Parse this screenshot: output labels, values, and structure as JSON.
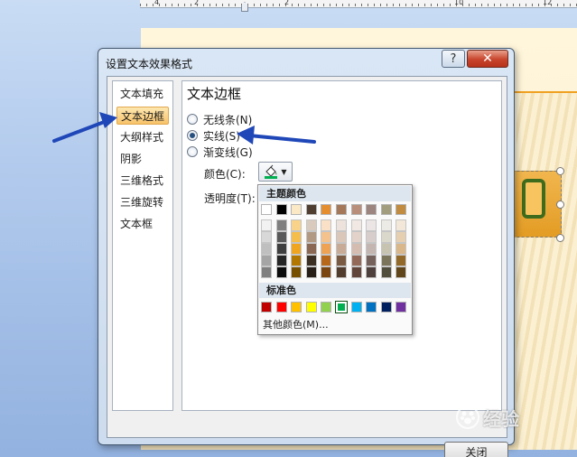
{
  "ruler": {
    "numbers": [
      "4",
      "2",
      "2",
      "10",
      "12"
    ]
  },
  "dialog": {
    "title": "设置文本效果格式",
    "help_label": "?",
    "close_label": "✕",
    "close_button_label": "关闭"
  },
  "nav": {
    "items": [
      {
        "label": "文本填充"
      },
      {
        "label": "文本边框",
        "selected": true
      },
      {
        "label": "大纲样式"
      },
      {
        "label": "阴影"
      },
      {
        "label": "三维格式"
      },
      {
        "label": "三维旋转"
      },
      {
        "label": "文本框"
      }
    ]
  },
  "pane": {
    "title": "文本边框",
    "radios": [
      {
        "label": "无线条(N)",
        "checked": false
      },
      {
        "label": "实线(S)",
        "checked": true
      },
      {
        "label": "渐变线(G)",
        "checked": false
      }
    ],
    "color_label": "颜色(C):",
    "transparency_label": "透明度(T):"
  },
  "color_menu": {
    "theme_header": "主题颜色",
    "standard_header": "标准色",
    "more_colors_label": "其他颜色(M)...",
    "theme_colors": [
      [
        "#ffffff",
        "#f2f2f2",
        "#d8d8d8",
        "#bfbfbf",
        "#a5a5a5",
        "#7f7f7f"
      ],
      [
        "#000000",
        "#7f7f7f",
        "#595959",
        "#3f3f3f",
        "#262626",
        "#0c0c0c"
      ],
      [
        "#fbe9c6",
        "#f8d389",
        "#f5bd4c",
        "#efa520",
        "#b17700",
        "#764f00"
      ],
      [
        "#4f3e2f",
        "#d8cbbd",
        "#b19984",
        "#8a6853",
        "#3b2e23",
        "#271f17"
      ],
      [
        "#e48e2f",
        "#f9e0c6",
        "#f4c28d",
        "#eea354",
        "#b8681a",
        "#7a4510"
      ],
      [
        "#a5785a",
        "#ede3dc",
        "#dac7ba",
        "#c8ab97",
        "#7b5a43",
        "#523c2d"
      ],
      [
        "#b98f7c",
        "#f1e8e4",
        "#e3d2ca",
        "#d5bcb0",
        "#93695a",
        "#62463c"
      ],
      [
        "#9b857e",
        "#ebe6e5",
        "#d7cecb",
        "#c3b6b1",
        "#76625c",
        "#4e413d"
      ],
      [
        "#a39d7f",
        "#ecebe5",
        "#dad7cb",
        "#c7c3b1",
        "#7b765b",
        "#524e3d"
      ],
      [
        "#c18b40",
        "#f2e7d8",
        "#e6cfb1",
        "#d9b78a",
        "#936929",
        "#62461b"
      ]
    ],
    "standard_colors": [
      "#c00000",
      "#ff0000",
      "#ffc000",
      "#ffff00",
      "#92d050",
      "#00b050",
      "#00b0f0",
      "#0070c0",
      "#002060",
      "#7030a0"
    ],
    "selected_standard_index": 5
  },
  "watermark": {
    "text": "经验"
  },
  "colors": {
    "accent": "#2a52be",
    "nav_selected": "#f8c36a",
    "arrow": "#1f47b8"
  }
}
